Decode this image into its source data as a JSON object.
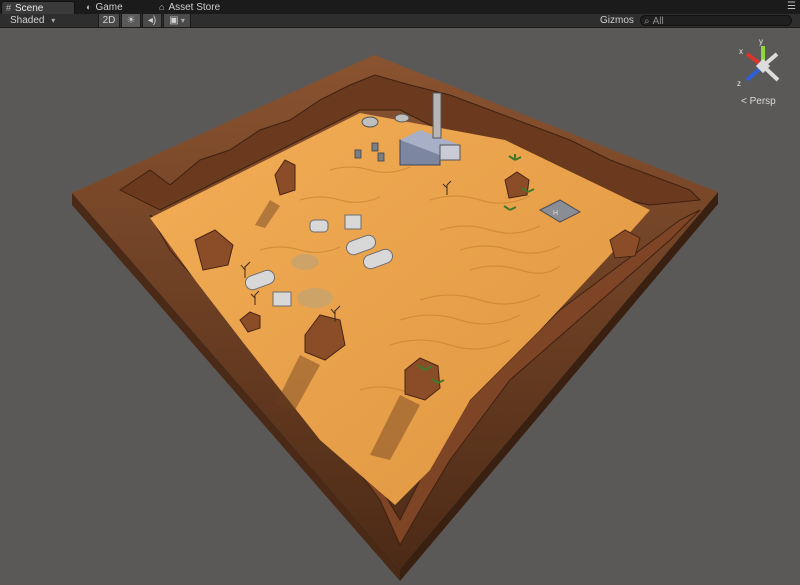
{
  "tabs": [
    {
      "label": "Scene",
      "icon": "scene-grid-icon"
    },
    {
      "label": "Game",
      "icon": "pacman-icon"
    },
    {
      "label": "Asset Store",
      "icon": "bag-icon"
    }
  ],
  "toolbar": {
    "render_mode": "Shaded",
    "mode_2d": "2D",
    "lighting_icon": "sun-icon",
    "audio_icon": "speaker-icon",
    "effects_icon": "image-icon",
    "gizmos_label": "Gizmos",
    "search_placeholder": "All"
  },
  "gizmo": {
    "y_label": "y",
    "x_label": "x",
    "z_label": "z",
    "projection": "Persp"
  },
  "colors": {
    "sand": "#e79e45",
    "cliff": "#7a4526",
    "background": "#5b5957"
  }
}
